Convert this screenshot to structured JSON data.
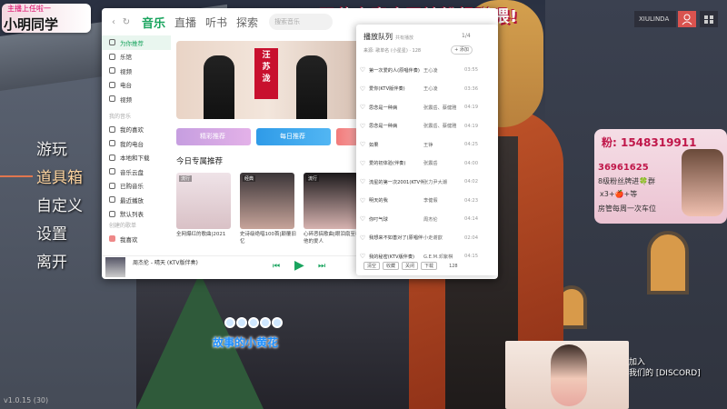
{
  "stream": {
    "streamer_subtitle": "主播上任啦一",
    "streamer_name": "小明同学",
    "banner": "双倍亲密度开钻粉超赚喂!",
    "qq_line": "粉: 1548319911",
    "fan_count": "36961625",
    "fan_group": "8级粉丝牌进🍀群",
    "promo1": "x3+🍎+等",
    "promo2": "房管每周一次车位",
    "discord_line1": "加入",
    "discord_line2": "我们的 [DISCORD]",
    "lyric": "故事的小黄花"
  },
  "game": {
    "menu": [
      "游玩",
      "道具箱",
      "自定义",
      "设置",
      "离开"
    ],
    "active_index": 1,
    "version": "v1.0.15 (30)",
    "user": "XIULINDA"
  },
  "app": {
    "tabs": [
      "音乐",
      "直播",
      "听书",
      "探索"
    ],
    "search_placeholder": "搜索音乐",
    "sidebar_top": [
      "为你推荐",
      "乐馆",
      "视频",
      "电台",
      "视频"
    ],
    "sidebar_head": "我的音乐",
    "sidebar_mine": [
      "我的喜欢",
      "我的电台",
      "本地和下载",
      "音乐云盘",
      "已购音乐",
      "最近播放",
      "默认列表"
    ],
    "sidebar_list_head": "创建的歌单",
    "sidebar_playlist": "我喜欢",
    "quick_buttons": [
      "精彩推荐",
      "每日推荐"
    ],
    "section_title": "今日专属推荐",
    "cards": [
      {
        "tag": "流行",
        "caption": "全网爆红的歌曲|2021"
      },
      {
        "tag": "经典",
        "caption": "史诗级绝唱100首|颠覆旧忆"
      },
      {
        "tag": "流行",
        "caption": "心碎恶搞歌曲|眼泪扇至视他的爱人"
      }
    ],
    "player": {
      "title": "周杰伦 - 晴天 (KTV版伴奏)"
    }
  },
  "queue": {
    "title": "播放队列",
    "subtitle": "共有播放",
    "page": "1/4",
    "meta": "来源: 歌单名 (小星星) · 128",
    "add_label": "+ 添加",
    "rows": [
      {
        "song": "第一次爱的人(原唱伴奏)",
        "artist": "王心凌",
        "dur": "03:55"
      },
      {
        "song": "爱你(KTV版伴奏)",
        "artist": "王心凌",
        "dur": "03:36"
      },
      {
        "song": "思念是一种病",
        "artist": "张震岳、蔡健雅",
        "dur": "04:19"
      },
      {
        "song": "思念是一种病",
        "artist": "张震岳、蔡健雅",
        "dur": "04:19"
      },
      {
        "song": "如果",
        "artist": "王铮",
        "dur": "04:25"
      },
      {
        "song": "爱的初体验(伴奏)",
        "artist": "张震岳",
        "dur": "04:00"
      },
      {
        "song": "流星的第一次2001(KTV伴奏...",
        "artist": "张力尹大潮",
        "dur": "04:02"
      },
      {
        "song": "明天的我",
        "artist": "李健假",
        "dur": "04:23"
      },
      {
        "song": "你叮气球",
        "artist": "周杰伦",
        "dur": "04:14"
      },
      {
        "song": "我想来不如善对了(原唱伴奏)",
        "artist": "小走谢歆",
        "dur": "02:04"
      },
      {
        "song": "我的秘密(KTV版伴奏)",
        "artist": "G.E.M.邓紫棋",
        "dur": "04:15"
      }
    ],
    "footer": [
      "清空",
      "收藏",
      "关闭",
      "下载"
    ],
    "count": "128"
  }
}
